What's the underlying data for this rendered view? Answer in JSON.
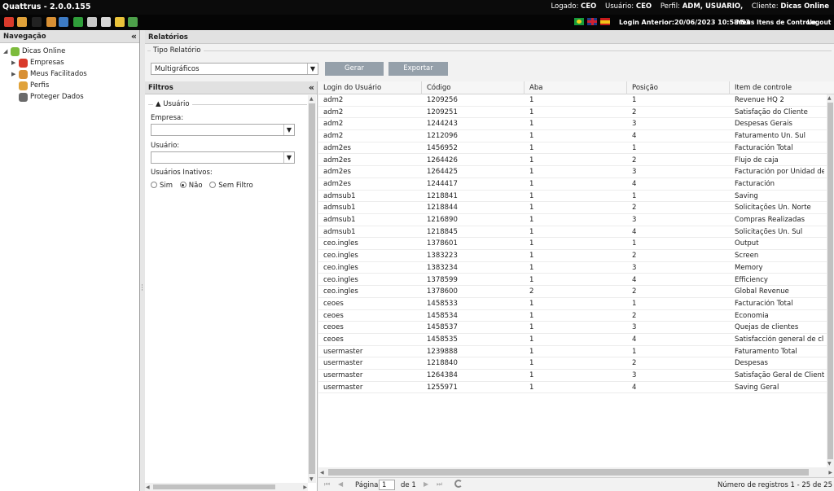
{
  "app": {
    "title": "Quattrus - 2.0.0.155"
  },
  "user_info": {
    "logado_label": "Logado:",
    "logado_value": "CEO",
    "usuario_label": "Usuário:",
    "usuario_value": "CEO",
    "perfil_label": "Perfil:",
    "perfil_value": "ADM, USUARIO,",
    "cliente_label": "Cliente:",
    "cliente_value": "Dicas Online"
  },
  "toolbar": {
    "icons": [
      {
        "name": "rocket-icon",
        "color": "#d93a2b"
      },
      {
        "name": "users-icon",
        "color": "#e0a23a"
      },
      {
        "name": "dark-square-icon",
        "color": "#222222"
      },
      {
        "name": "user-gear-icon",
        "color": "#d89035"
      },
      {
        "name": "table-icon",
        "color": "#3d7bc4"
      },
      {
        "name": "refresh-green-icon",
        "color": "#2f9e3a"
      },
      {
        "name": "printer-icon",
        "color": "#c8c8c8"
      },
      {
        "name": "document-icon",
        "color": "#d8d8d8"
      },
      {
        "name": "shield-icon",
        "color": "#e9c23a"
      },
      {
        "name": "export-icon",
        "color": "#4da04a"
      }
    ],
    "last_login": "Login Anterior:20/06/2023 10:58:53",
    "my_controls": "Meus Itens de Controle",
    "logout": "Logout"
  },
  "nav": {
    "title": "Navegação",
    "items": [
      {
        "label": "Dicas Online",
        "icon": "group-icon",
        "color": "#7dbb3c"
      },
      {
        "label": "Empresas",
        "icon": "rocket-icon",
        "color": "#d93a2b"
      },
      {
        "label": "Meus Facilitados",
        "icon": "user-icon",
        "color": "#d89035"
      },
      {
        "label": "Perfis",
        "icon": "users-icon",
        "color": "#e0a23a"
      },
      {
        "label": "Proteger Dados",
        "icon": "table-icon",
        "color": "#6a6a6a"
      }
    ]
  },
  "main": {
    "title": "Relatórios",
    "tipo_label": "Tipo Relatório",
    "tipo_value": "Multigráficos",
    "gerar": "Gerar",
    "exportar": "Exportar"
  },
  "filters": {
    "title": "Filtros",
    "group_label": "Usuário",
    "empresa_label": "Empresa:",
    "usuario_label": "Usuário:",
    "inativos_label": "Usuários Inativos:",
    "opt_sim": "Sim",
    "opt_nao": "Não",
    "opt_sem": "Sem Filtro"
  },
  "grid": {
    "columns": [
      "Login do Usuário",
      "Código",
      "Aba",
      "Posição",
      "Item de controle"
    ],
    "rows": [
      [
        "adm2",
        "1209256",
        "1",
        "1",
        "Revenue HQ 2"
      ],
      [
        "adm2",
        "1209251",
        "1",
        "2",
        "Satisfação do Cliente"
      ],
      [
        "adm2",
        "1244243",
        "1",
        "3",
        "Despesas Gerais"
      ],
      [
        "adm2",
        "1212096",
        "1",
        "4",
        "Faturamento Un. Sul"
      ],
      [
        "adm2es",
        "1456952",
        "1",
        "1",
        "Facturación Total"
      ],
      [
        "adm2es",
        "1264426",
        "1",
        "2",
        "Flujo de caja"
      ],
      [
        "adm2es",
        "1264425",
        "1",
        "3",
        "Facturación por Unidad del Sur"
      ],
      [
        "adm2es",
        "1244417",
        "1",
        "4",
        "Facturación"
      ],
      [
        "admsub1",
        "1218841",
        "1",
        "1",
        "Saving"
      ],
      [
        "admsub1",
        "1218844",
        "1",
        "2",
        "Solicitações Un. Norte"
      ],
      [
        "admsub1",
        "1216890",
        "1",
        "3",
        "Compras Realizadas"
      ],
      [
        "admsub1",
        "1218845",
        "1",
        "4",
        "Solicitações Un. Sul"
      ],
      [
        "ceo.ingles",
        "1378601",
        "1",
        "1",
        "Output"
      ],
      [
        "ceo.ingles",
        "1383223",
        "1",
        "2",
        "Screen"
      ],
      [
        "ceo.ingles",
        "1383234",
        "1",
        "3",
        "Memory"
      ],
      [
        "ceo.ingles",
        "1378599",
        "1",
        "4",
        "Efficiency"
      ],
      [
        "ceo.ingles",
        "1378600",
        "2",
        "2",
        "Global Revenue"
      ],
      [
        "ceoes",
        "1458533",
        "1",
        "1",
        "Facturación Total"
      ],
      [
        "ceoes",
        "1458534",
        "1",
        "2",
        "Economia"
      ],
      [
        "ceoes",
        "1458537",
        "1",
        "3",
        "Quejas de clientes"
      ],
      [
        "ceoes",
        "1458535",
        "1",
        "4",
        "Satisfacción general de clientes"
      ],
      [
        "usermaster",
        "1239888",
        "1",
        "1",
        "Faturamento Total"
      ],
      [
        "usermaster",
        "1218840",
        "1",
        "2",
        "Despesas"
      ],
      [
        "usermaster",
        "1264384",
        "1",
        "3",
        "Satisfação Geral de Clientes"
      ],
      [
        "usermaster",
        "1255971",
        "1",
        "4",
        "Saving Geral"
      ]
    ]
  },
  "pager": {
    "page_label": "Página",
    "page_value": "1",
    "of_label": "de 1",
    "count": "Número de registros 1 - 25 de 25"
  }
}
